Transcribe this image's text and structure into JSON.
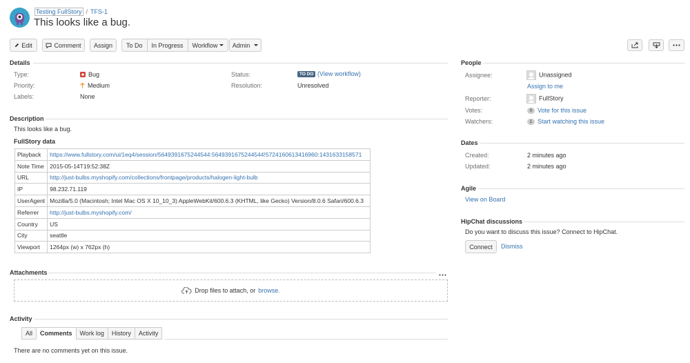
{
  "breadcrumb": {
    "project": "Testing FullStory",
    "issue_key": "TFS-1"
  },
  "issue": {
    "summary": "This looks like a bug."
  },
  "toolbar": {
    "edit": "Edit",
    "comment": "Comment",
    "assign": "Assign",
    "todo": "To Do",
    "in_progress": "In Progress",
    "workflow": "Workflow",
    "admin": "Admin"
  },
  "details": {
    "heading": "Details",
    "type_label": "Type:",
    "type_value": "Bug",
    "priority_label": "Priority:",
    "priority_value": "Medium",
    "labels_label": "Labels:",
    "labels_value": "None",
    "status_label": "Status:",
    "status_badge": "TO DO",
    "status_link": "(View workflow)",
    "resolution_label": "Resolution:",
    "resolution_value": "Unresolved",
    "colors": {
      "bug": "#d04437",
      "priority": "#f79232",
      "status": "#4a6785"
    }
  },
  "description": {
    "heading": "Description",
    "text": "This looks like a bug.",
    "fullstory_heading": "FullStory data",
    "rows": [
      {
        "key": "Playback",
        "value": "https://www.fullstory.com/ui/1eq4/session/5649391675244544:5649391675244544!5724160613416960:1431633158571",
        "link": true
      },
      {
        "key": "Note Time",
        "value": "2015-05-14T19:52:38Z",
        "link": false
      },
      {
        "key": "URL",
        "value": "http://just-bulbs.myshopify.com/collections/frontpage/products/halogen-light-bulb",
        "link": true
      },
      {
        "key": "IP",
        "value": "98.232.71.119",
        "link": false
      },
      {
        "key": "UserAgent",
        "value": "Mozilla/5.0 (Macintosh; Intel Mac OS X 10_10_3) AppleWebKit/600.6.3 (KHTML, like Gecko) Version/8.0.6 Safari/600.6.3",
        "link": false
      },
      {
        "key": "Referrer",
        "value": "http://just-bulbs.myshopify.com/",
        "link": true
      },
      {
        "key": "Country",
        "value": "US",
        "link": false
      },
      {
        "key": "City",
        "value": "seattle",
        "link": false
      },
      {
        "key": "Viewport",
        "value": "1264px (w) x 762px (h)",
        "link": false
      }
    ]
  },
  "attachments": {
    "heading": "Attachments",
    "drop_text": "Drop files to attach, or",
    "browse": "browse."
  },
  "activity": {
    "heading": "Activity",
    "tabs": [
      "All",
      "Comments",
      "Work log",
      "History",
      "Activity"
    ],
    "empty": "There are no comments yet on this issue."
  },
  "people": {
    "heading": "People",
    "assignee_label": "Assignee:",
    "assignee_value": "Unassigned",
    "assign_to_me": "Assign to me",
    "reporter_label": "Reporter:",
    "reporter_value": "FullStory",
    "votes_label": "Votes:",
    "votes_count": "0",
    "votes_link": "Vote for this issue",
    "watchers_label": "Watchers:",
    "watchers_count": "1",
    "watchers_link": "Start watching this issue"
  },
  "dates": {
    "heading": "Dates",
    "created_label": "Created:",
    "created_value": "2 minutes ago",
    "updated_label": "Updated:",
    "updated_value": "2 minutes ago"
  },
  "agile": {
    "heading": "Agile",
    "link": "View on Board"
  },
  "hipchat": {
    "heading": "HipChat discussions",
    "text": "Do you want to discuss this issue? Connect to HipChat.",
    "connect": "Connect",
    "dismiss": "Dismiss"
  }
}
